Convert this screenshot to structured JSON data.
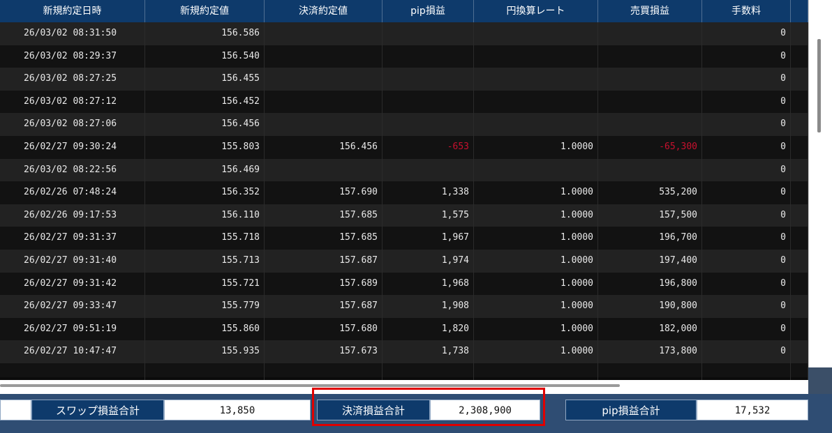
{
  "headers": [
    "新規約定日時",
    "新規約定値",
    "決済約定値",
    "pip損益",
    "円換算レート",
    "売買損益",
    "手数料",
    ""
  ],
  "rows": [
    [
      "26/03/02 08:31:50",
      "156.586",
      "",
      "",
      "",
      "",
      "0"
    ],
    [
      "26/03/02 08:29:37",
      "156.540",
      "",
      "",
      "",
      "",
      "0"
    ],
    [
      "26/03/02 08:27:25",
      "156.455",
      "",
      "",
      "",
      "",
      "0"
    ],
    [
      "26/03/02 08:27:12",
      "156.452",
      "",
      "",
      "",
      "",
      "0"
    ],
    [
      "26/03/02 08:27:06",
      "156.456",
      "",
      "",
      "",
      "",
      "0"
    ],
    [
      "26/02/27 09:30:24",
      "155.803",
      "156.456",
      "-653",
      "1.0000",
      "-65,300",
      "0"
    ],
    [
      "26/03/02 08:22:56",
      "156.469",
      "",
      "",
      "",
      "",
      "0"
    ],
    [
      "26/02/26 07:48:24",
      "156.352",
      "157.690",
      "1,338",
      "1.0000",
      "535,200",
      "0"
    ],
    [
      "26/02/26 09:17:53",
      "156.110",
      "157.685",
      "1,575",
      "1.0000",
      "157,500",
      "0"
    ],
    [
      "26/02/27 09:31:37",
      "155.718",
      "157.685",
      "1,967",
      "1.0000",
      "196,700",
      "0"
    ],
    [
      "26/02/27 09:31:40",
      "155.713",
      "157.687",
      "1,974",
      "1.0000",
      "197,400",
      "0"
    ],
    [
      "26/02/27 09:31:42",
      "155.721",
      "157.689",
      "1,968",
      "1.0000",
      "196,800",
      "0"
    ],
    [
      "26/02/27 09:33:47",
      "155.779",
      "157.687",
      "1,908",
      "1.0000",
      "190,800",
      "0"
    ],
    [
      "26/02/27 09:51:19",
      "155.860",
      "157.680",
      "1,820",
      "1.0000",
      "182,000",
      "0"
    ],
    [
      "26/02/27 10:47:47",
      "155.935",
      "157.673",
      "1,738",
      "1.0000",
      "173,800",
      "0"
    ]
  ],
  "summary": {
    "swap_label": "スワップ損益合計",
    "swap_value": "13,850",
    "settle_label": "決済損益合計",
    "settle_value": "2,308,900",
    "pip_label": "pip損益合計",
    "pip_value": "17,532"
  },
  "colors": {
    "header_bg": "#0e3a6b",
    "negative": "#c8102e",
    "highlight_box": "#e00000",
    "frame_bg": "#2f4d73"
  }
}
